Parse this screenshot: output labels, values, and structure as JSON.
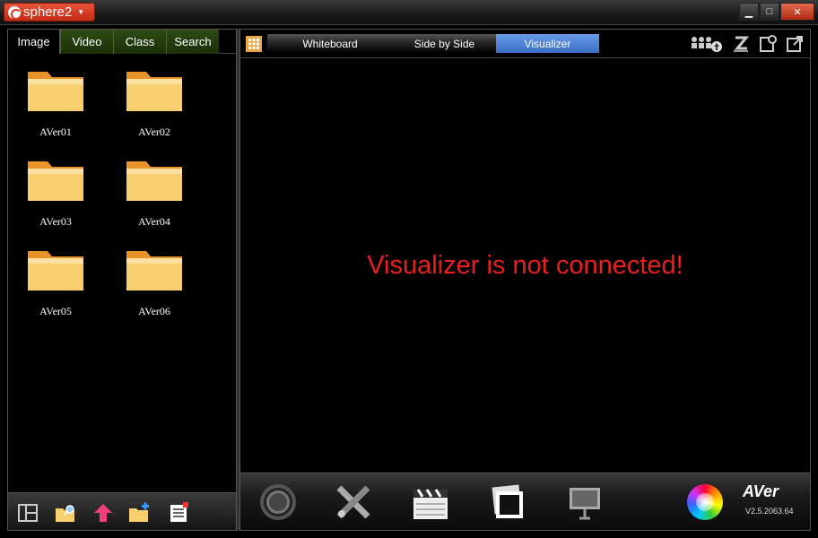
{
  "app": {
    "name": "sphere2"
  },
  "window": {
    "minimize": "▁",
    "maximize": "□",
    "close": "✕"
  },
  "left_tabs": [
    "Image",
    "Video",
    "Class",
    "Search"
  ],
  "folders": [
    "AVer01",
    "AVer02",
    "AVer03",
    "AVer04",
    "AVer05",
    "AVer06"
  ],
  "mode_tabs": [
    "Whiteboard",
    "Side by Side",
    "Visualizer"
  ],
  "active_mode": "Visualizer",
  "status_message": "Visualizer is not connected!",
  "brand": "AVer",
  "version": "V2.5.2063.64",
  "colors": {
    "accent": "#d0361e",
    "status": "#e82020",
    "active_tab": "#4a7fd8",
    "folder": "#f5b84a"
  },
  "icons": {
    "left_bottom": [
      "layout-icon",
      "folder-search-icon",
      "upload-arrow-icon",
      "new-folder-icon",
      "list-icon"
    ],
    "toolbar": [
      "users-upload-icon",
      "signature-icon",
      "note-icon",
      "export-icon"
    ],
    "dock": [
      "camera-lens-icon",
      "tools-icon",
      "clapperboard-icon",
      "photos-icon",
      "presentation-icon"
    ]
  }
}
